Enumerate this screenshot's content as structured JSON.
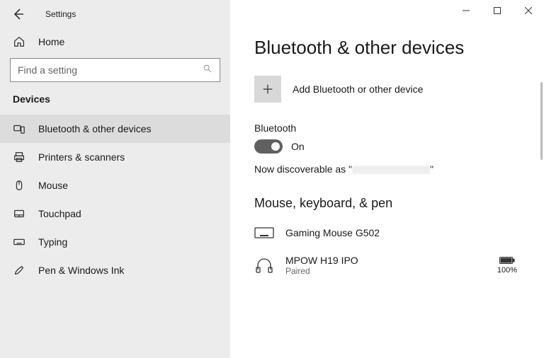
{
  "window": {
    "title": "Settings"
  },
  "sidebar": {
    "home": "Home",
    "search_placeholder": "Find a setting",
    "category": "Devices",
    "items": [
      {
        "label": "Bluetooth & other devices"
      },
      {
        "label": "Printers & scanners"
      },
      {
        "label": "Mouse"
      },
      {
        "label": "Touchpad"
      },
      {
        "label": "Typing"
      },
      {
        "label": "Pen & Windows Ink"
      }
    ]
  },
  "page": {
    "title": "Bluetooth & other devices",
    "add_label": "Add Bluetooth or other device",
    "bluetooth_heading": "Bluetooth",
    "toggle_state": "On",
    "discoverable_prefix": "Now discoverable as \"",
    "discoverable_suffix": "\"",
    "section2": "Mouse, keyboard, & pen",
    "devices": [
      {
        "name": "Gaming Mouse G502",
        "status": ""
      },
      {
        "name": "MPOW H19 IPO",
        "status": "Paired",
        "battery": "100%"
      }
    ]
  }
}
